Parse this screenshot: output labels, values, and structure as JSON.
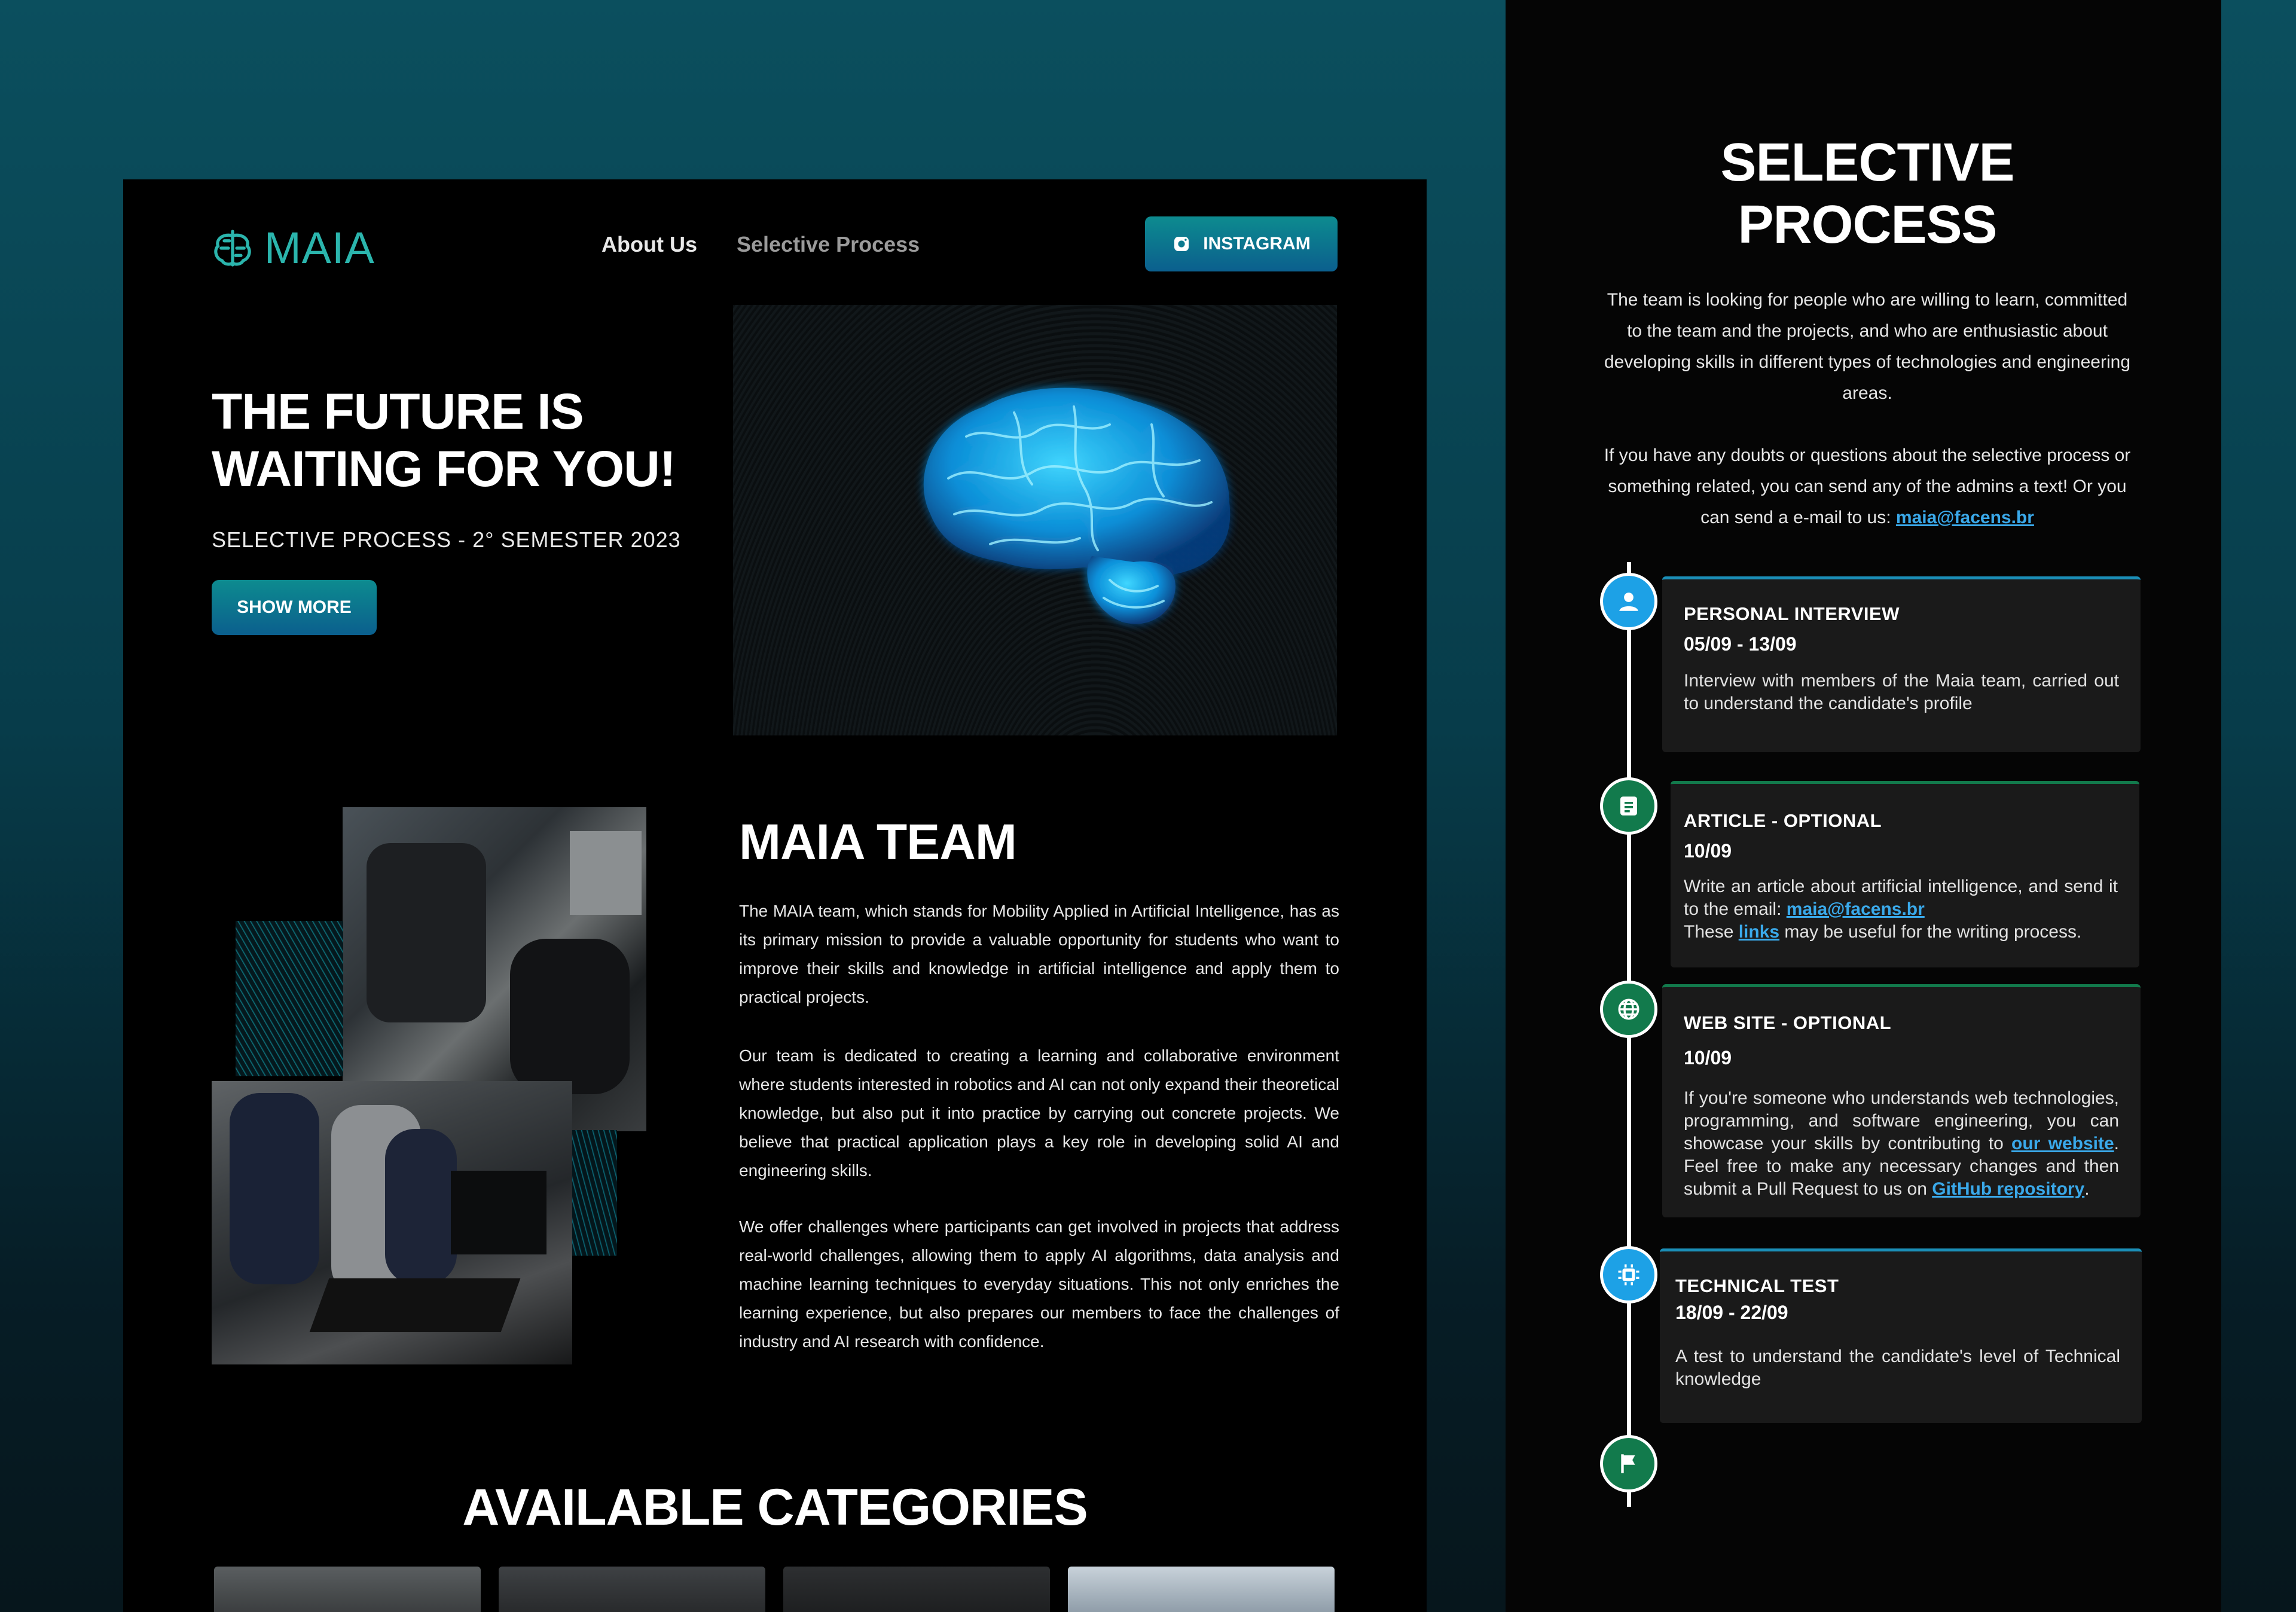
{
  "nav": {
    "logo_text": "MAIA",
    "links": [
      "About Us",
      "Selective Process"
    ],
    "instagram_label": "INSTAGRAM"
  },
  "hero": {
    "title": "THE FUTURE IS WAITING FOR YOU!",
    "subtitle": "SELECTIVE PROCESS - 2° SEMESTER 2023",
    "button": "SHOW MORE"
  },
  "team": {
    "title": "MAIA TEAM",
    "paragraphs": [
      "The MAIA team, which stands for Mobility Applied in Artificial Intelligence, has as its primary mission to provide a valuable opportunity for students who want to improve their skills and knowledge in artificial intelligence and apply them to practical projects.",
      "Our team is dedicated to creating a learning and collaborative environment where students interested in robotics and AI can not only expand their theoretical knowledge, but also put it into practice by carrying out concrete projects. We believe that practical application plays a key role in developing solid AI and engineering skills.",
      "We offer challenges where participants can get involved in projects that address real-world challenges, allowing them to apply AI algorithms, data analysis and machine learning techniques to everyday situations. This not only enriches the learning experience, but also prepares our members to face the challenges of industry and AI research with confidence."
    ]
  },
  "categories": {
    "title": "AVAILABLE CATEGORIES"
  },
  "selective": {
    "title_line1": "SELECTIVE",
    "title_line2": "PROCESS",
    "intro": "The team is looking for people who are willing to learn, committed to the team and the projects, and who are enthusiastic about developing skills in different types of technologies and engineering areas.",
    "contact": "If you have any doubts or questions about the selective process or something related, you can send any of the admins a text! Or you can send a e-mail to us: ",
    "email": "maia@facens.br",
    "steps": [
      {
        "title": "PERSONAL INTERVIEW",
        "date": "05/09 - 13/09",
        "desc": "Interview with members of the Maia team, carried out to understand the candidate's profile",
        "icon": "user-icon"
      },
      {
        "title": "ARTICLE - OPTIONAL",
        "date": "10/09",
        "desc_a": "Write an article about artificial intelligence, and send it to the email: ",
        "email": "maia@facens.br",
        "desc_b": "These ",
        "link": "links",
        "desc_c": " may be useful for the writing process.",
        "icon": "document-icon"
      },
      {
        "title": "WEB SITE  - OPTIONAL",
        "date": "10/09",
        "desc_a": "If you're someone who understands web technologies, programming, and software engineering, you can showcase your skills by contributing to ",
        "link1": "our website",
        "desc_b": ". Feel free to make any necessary changes and then submit a Pull Request to us on ",
        "link2": "GitHub repository",
        "desc_c": ".",
        "icon": "globe-icon"
      },
      {
        "title": "TECHNICAL TEST",
        "date": "18/09 - 22/09",
        "desc": "A test to understand the candidate's level of Technical knowledge",
        "icon": "chip-icon"
      }
    ],
    "end_icon": "flag-icon"
  },
  "colors": {
    "accent_teal": "#2bb5ad",
    "button_gradient": [
      "#0d8b8f",
      "#0b5f8e"
    ],
    "timeline_blue": "#1da1e6",
    "timeline_green": "#127a4c",
    "link": "#3aa9ea"
  }
}
